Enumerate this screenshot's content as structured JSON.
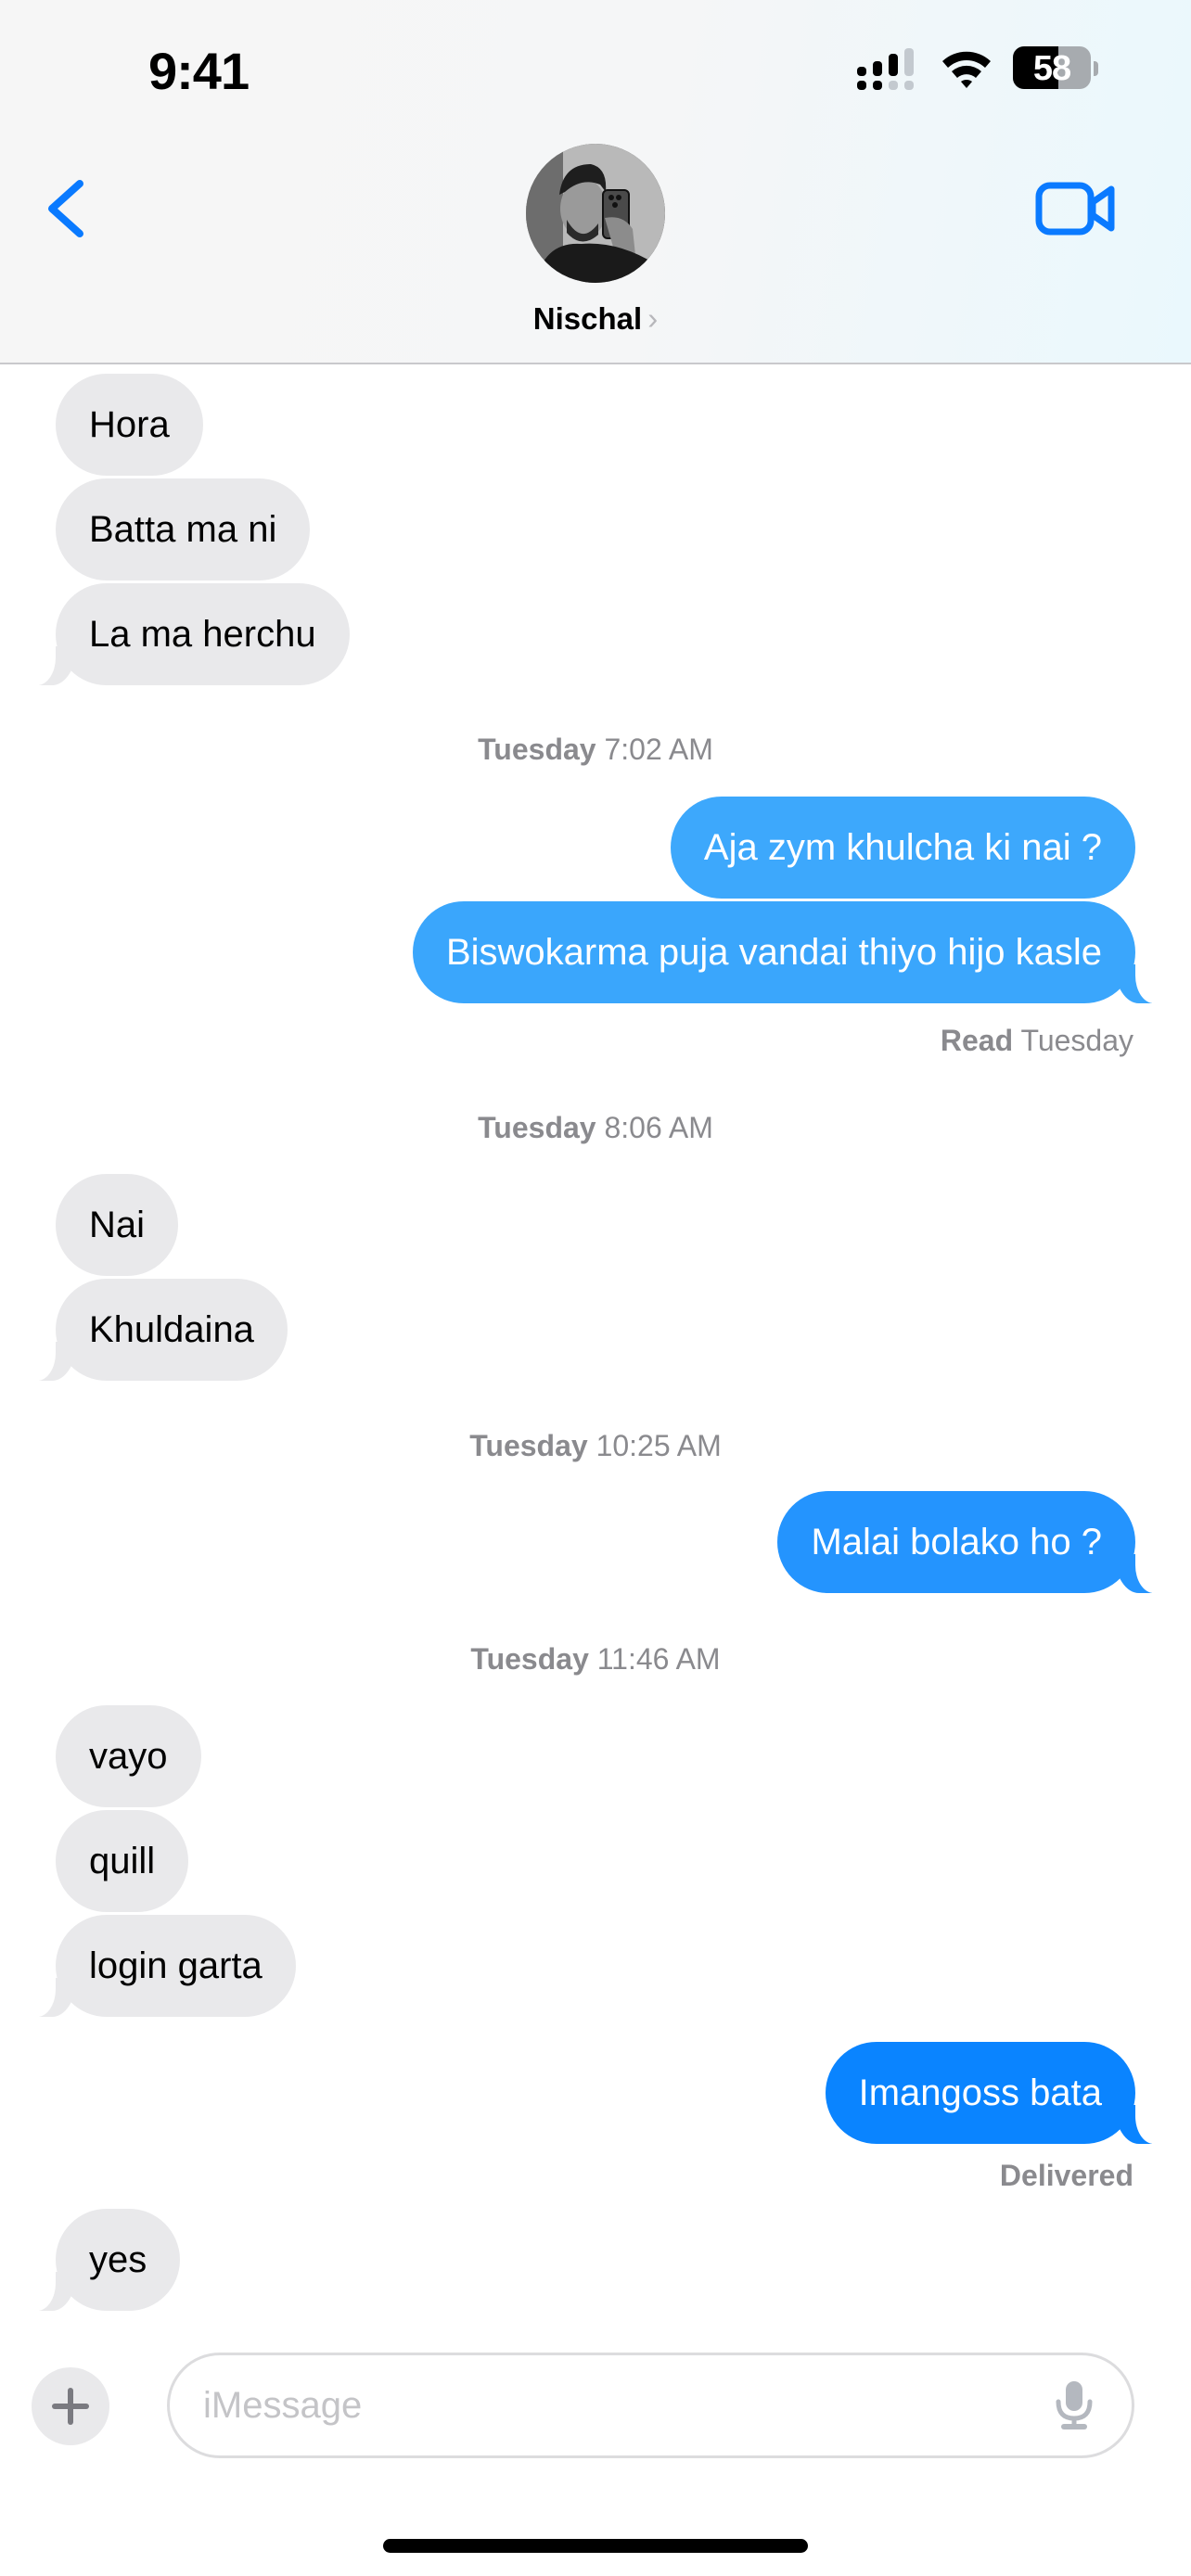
{
  "status_bar": {
    "time": "9:41",
    "battery_percent": "58",
    "battery_level": 0.58,
    "icons": [
      "signal-icon",
      "wifi-icon",
      "battery-icon"
    ]
  },
  "header": {
    "back_icon": "chevron-left-icon",
    "contact_name": "Nischal",
    "contact_chevron": "›",
    "video_icon": "video-camera-icon",
    "accent_color": "#0A7AFF"
  },
  "conversation": {
    "timestamps": [
      {
        "day": "Tuesday",
        "time": "7:02 AM"
      },
      {
        "day": "Tuesday",
        "time": "8:06 AM"
      },
      {
        "day": "Tuesday",
        "time": "10:25 AM"
      },
      {
        "day": "Tuesday",
        "time": "11:46 AM"
      }
    ],
    "messages": [
      {
        "direction": "received",
        "text": "Hora"
      },
      {
        "direction": "received",
        "text": "Batta ma ni"
      },
      {
        "direction": "received",
        "text": "La ma herchu"
      },
      {
        "direction": "sent",
        "text": "Aja zym khulcha ki nai ?"
      },
      {
        "direction": "sent",
        "text": "Biswokarma puja vandai thiyo hijo kasle"
      },
      {
        "direction": "received",
        "text": "Nai"
      },
      {
        "direction": "received",
        "text": "Khuldaina"
      },
      {
        "direction": "sent",
        "text": "Malai bolako ho ?"
      },
      {
        "direction": "received",
        "text": "vayo"
      },
      {
        "direction": "received",
        "text": "quill"
      },
      {
        "direction": "received",
        "text": "login garta"
      },
      {
        "direction": "sent",
        "text": "Imangoss bata"
      },
      {
        "direction": "received",
        "text": "yes"
      }
    ],
    "read_receipt": {
      "label": "Read",
      "when": "Tuesday"
    },
    "delivered_receipt": "Delivered",
    "colors": {
      "received_bubble": "#E9E9EB",
      "sent_bubble_top": "#3DA8FC",
      "sent_bubble_mid": "#2494FE",
      "sent_bubble_bottom": "#0A84FF",
      "timestamp_text": "#8A8A8E"
    }
  },
  "composer": {
    "plus_icon": "plus-icon",
    "placeholder": "iMessage",
    "value": "",
    "mic_icon": "microphone-icon"
  }
}
